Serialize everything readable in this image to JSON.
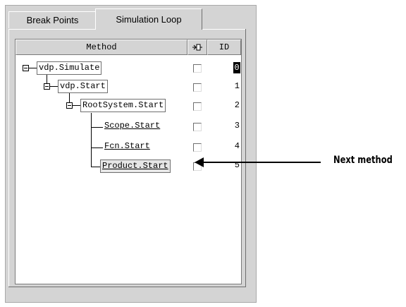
{
  "tabs": [
    {
      "label": "Break Points",
      "active": false
    },
    {
      "label": "Simulation Loop",
      "active": true
    }
  ],
  "table": {
    "columns": {
      "method": "Method",
      "breakpoint_icon": "breakpoint-column-icon",
      "id": "ID"
    },
    "rows": [
      {
        "method": "vdp.Simulate",
        "id": "0",
        "breakpoint": false,
        "expanded": true,
        "current_id": true
      },
      {
        "method": "vdp.Start",
        "id": "1",
        "breakpoint": false,
        "expanded": true
      },
      {
        "method": "RootSystem.Start",
        "id": "2",
        "breakpoint": false,
        "expanded": true
      },
      {
        "method": "Scope.Start",
        "id": "3",
        "breakpoint": false,
        "link": true
      },
      {
        "method": "Fcn.Start",
        "id": "4",
        "breakpoint": false,
        "link": true
      },
      {
        "method": "Product.Start",
        "id": "5",
        "breakpoint": false,
        "link": true,
        "next": true
      }
    ]
  },
  "callout": {
    "label": "Next method"
  },
  "colors": {
    "panel": "#d4d4d4",
    "border": "#6f6f6f",
    "current_id_bg": "#000000"
  }
}
